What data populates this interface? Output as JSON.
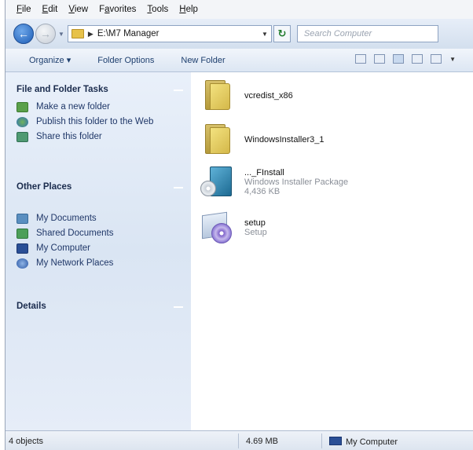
{
  "menu": [
    {
      "pre": "",
      "u": "F",
      "post": "ile"
    },
    {
      "pre": "",
      "u": "E",
      "post": "dit"
    },
    {
      "pre": "",
      "u": "V",
      "post": "iew"
    },
    {
      "pre": "F",
      "u": "a",
      "post": "vorites"
    },
    {
      "pre": "",
      "u": "T",
      "post": "ools"
    },
    {
      "pre": "",
      "u": "H",
      "post": "elp"
    }
  ],
  "address": {
    "path": "E:\\M7 Manager",
    "search_placeholder": "Search Computer"
  },
  "commands": {
    "organize": "Organize ▾",
    "folder_options": "Folder Options",
    "new_folder": "New Folder"
  },
  "tasks": {
    "file_folder_heading": "File and Folder Tasks",
    "file_folder_links": [
      {
        "label": "Make a new folder",
        "icon": "new-folder-icon"
      },
      {
        "label": "Publish this folder to the Web",
        "icon": "publish-web-icon"
      },
      {
        "label": "Share this folder",
        "icon": "share-folder-icon"
      }
    ],
    "other_places_heading": "Other Places",
    "other_places_links": [
      {
        "label": "My Documents",
        "icon": "my-documents-icon"
      },
      {
        "label": "Shared Documents",
        "icon": "shared-documents-icon"
      },
      {
        "label": "My Computer",
        "icon": "my-computer-icon"
      },
      {
        "label": "My Network Places",
        "icon": "network-places-icon"
      }
    ],
    "details_heading": "Details"
  },
  "files": [
    {
      "name": "vcredist_x86",
      "type": "",
      "size": "",
      "icon": "folder-icon"
    },
    {
      "name": "WindowsInstaller3_1",
      "type": "",
      "size": "",
      "icon": "folder-icon"
    },
    {
      "name": "..._FInstall",
      "type": "Windows Installer Package",
      "size": "4,436 KB",
      "icon": "installer-package-icon"
    },
    {
      "name": "setup",
      "type": "Setup",
      "size": "",
      "icon": "setup-icon"
    }
  ],
  "status": {
    "objects": "4 objects",
    "size": "4.69 MB",
    "location": "My Computer"
  }
}
